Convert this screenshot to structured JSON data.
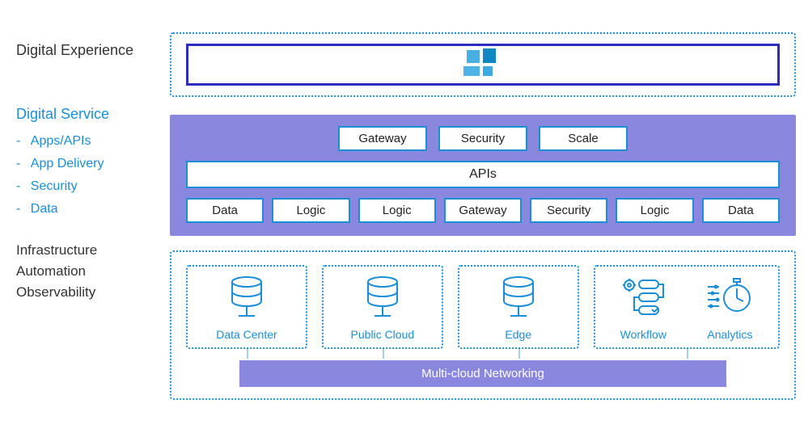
{
  "labels": {
    "experience": "Digital Experience",
    "service": "Digital Service",
    "service_items": [
      "Apps/APIs",
      "App Delivery",
      "Security",
      "Data"
    ],
    "infra_lines": [
      "Infrastructure",
      "Automation",
      "Observability"
    ]
  },
  "service": {
    "top_row": [
      "Gateway",
      "Security",
      "Scale"
    ],
    "apis": "APIs",
    "bottom_row": [
      "Data",
      "Logic",
      "Logic",
      "Gateway",
      "Security",
      "Logic",
      "Data"
    ]
  },
  "infra": {
    "cells": [
      "Data Center",
      "Public Cloud",
      "Edge"
    ],
    "right_pair": [
      "Workflow",
      "Analytics"
    ],
    "networking": "Multi-cloud Networking"
  }
}
